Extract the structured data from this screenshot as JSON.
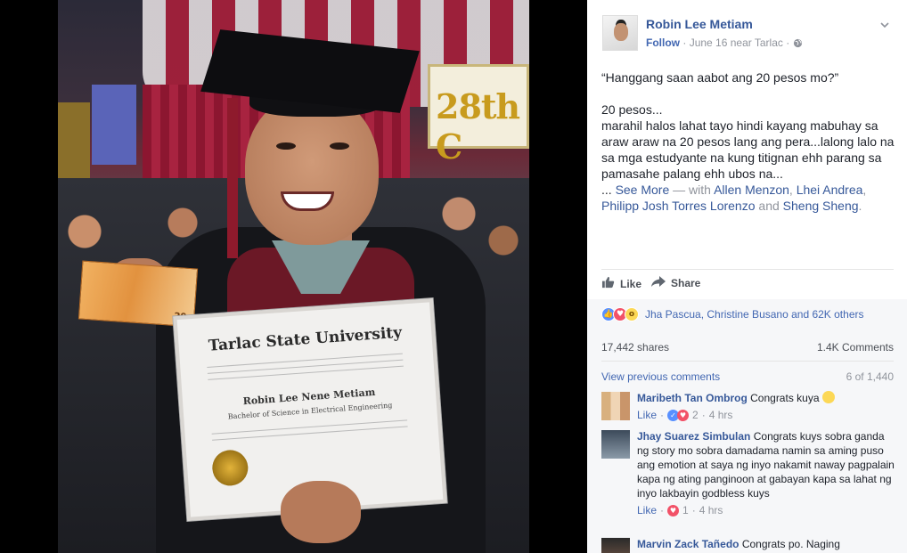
{
  "photo": {
    "banner_text": "28th C",
    "diploma_university": "Tarlac State University",
    "diploma_name": "Robin Lee Nene Metiam",
    "diploma_degree": "Bachelor of Science in Electrical Engineering",
    "money_denomination": "20"
  },
  "header": {
    "author": "Robin Lee Metiam",
    "follow_label": "Follow",
    "dot": "·",
    "date": "June 16 near Tarlac",
    "privacy_icon": "globe-icon",
    "menu_icon": "chevron-down-icon"
  },
  "post": {
    "quote": "“Hanggang saan aabot ang 20 pesos mo?”",
    "line1": "20 pesos...",
    "body": "marahil halos lahat tayo hindi kayang mabuhay sa araw araw na 20 pesos lang ang pera...lalong lalo na sa mga estudyante na kung titignan ehh parang sa pamasahe palang ehh ubos na...",
    "ellipsis": "...",
    "see_more": "See More",
    "with_text": "— with",
    "tag1": "Allen Menzon",
    "comma1": ",",
    "tag2": "Lhei Andrea",
    "comma2": ",",
    "tag3": "Philipp Josh Torres Lorenzo",
    "and_text": "and",
    "tag4": "Sheng Sheng",
    "end": "."
  },
  "actions": {
    "like_label": "Like",
    "share_label": "Share"
  },
  "reactions": {
    "names": "Jha Pascua, Christine Busano and 62K others"
  },
  "stats": {
    "shares": "17,442 shares",
    "comments": "1.4K Comments"
  },
  "comments_nav": {
    "view_previous": "View previous comments",
    "count": "6 of 1,440"
  },
  "comments": [
    {
      "name": "Maribeth Tan Ombrog",
      "text": "Congrats kuya",
      "like_label": "Like",
      "dot": "·",
      "reaction_count": "2",
      "time": "4 hrs"
    },
    {
      "name": "Jhay Suarez Simbulan",
      "text": "Congrats kuys sobra ganda ng story mo sobra damadama namin sa aming puso ang emotion at saya ng inyo nakamit naway pagpalain kapa ng ating panginoon at gabayan kapa sa lahat ng inyo lakbayin godbless kuys",
      "like_label": "Like",
      "dot": "·",
      "reaction_count": "1",
      "time": "4 hrs"
    },
    {
      "name": "Marvin Zack Tañedo",
      "text": "Congrats po. Naging"
    }
  ],
  "colors": {
    "link": "#365899",
    "accent": "#4267b2",
    "muted": "#90949c",
    "like": "#5890ff",
    "love": "#f25268",
    "wow": "#fcd856"
  }
}
